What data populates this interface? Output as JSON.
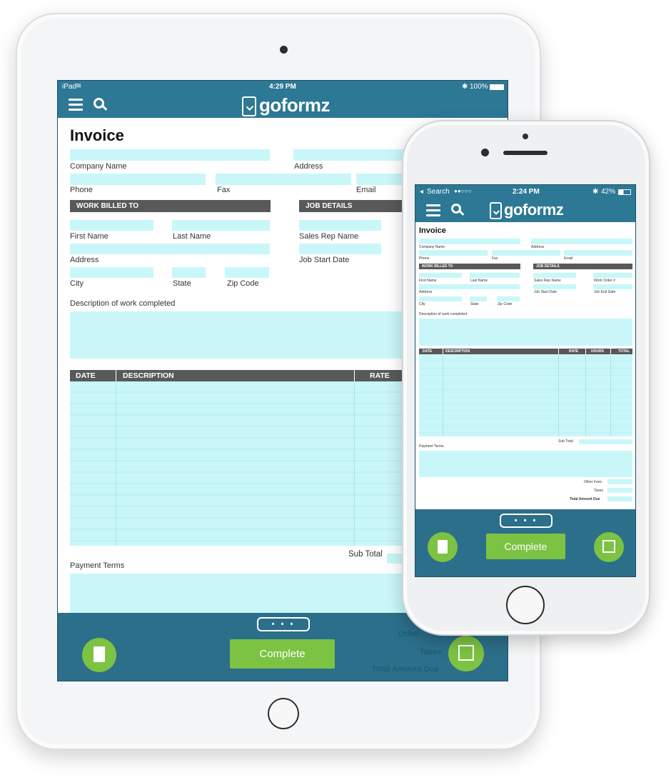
{
  "ipad": {
    "status": {
      "device": "iPad",
      "time": "4:29 PM",
      "battery": "100%"
    },
    "logo": "goformz",
    "form": {
      "title": "Invoice",
      "labels": {
        "company_name": "Company Name",
        "address": "Address",
        "phone": "Phone",
        "fax": "Fax",
        "email": "Email",
        "first_name": "First Name",
        "last_name": "Last Name",
        "sales_rep": "Sales Rep Name",
        "address2": "Address",
        "job_start": "Job Start Date",
        "city": "City",
        "state": "State",
        "zip": "Zip Code",
        "description": "Description of work completed",
        "payment_terms": "Payment Terms",
        "sub_total": "Sub Total",
        "other_fees": "Other",
        "taxes": "Taxes",
        "total_due": "Total Amount Due"
      },
      "sections": {
        "work_billed": "WORK BILLED TO",
        "job_details": "JOB DETAILS"
      },
      "table_columns": [
        "DATE",
        "DESCRIPTION",
        "RATE"
      ]
    },
    "bottom": {
      "more": "• • •",
      "complete": "Complete"
    }
  },
  "phone": {
    "status": {
      "carrier": "Search",
      "signal": "●●○○○",
      "time": "2:24 PM",
      "battery": "42%"
    },
    "logo": "goformz",
    "form": {
      "title": "Invoice",
      "labels": {
        "company_name": "Company Name",
        "address": "Address",
        "phone": "Phone",
        "fax": "Fax",
        "email": "Email",
        "first_name": "First Name",
        "last_name": "Last Name",
        "sales_rep": "Sales Rep Name",
        "work_order": "Work Order #",
        "address2": "Address",
        "job_start": "Job Start Date",
        "job_end": "Job End Date",
        "city": "City",
        "state": "State",
        "zip": "Zip Code",
        "description": "Description of work completed",
        "sub_total": "Sub Total",
        "payment_terms": "Payment Terms",
        "other_fees": "Other Fees",
        "taxes": "Taxes",
        "total_due": "Total Amount Due"
      },
      "sections": {
        "work_billed": "WORK BILLED TO",
        "job_details": "JOB DETAILS"
      },
      "table_columns": [
        "DATE",
        "DESCRIPTION",
        "RATE",
        "HOURS",
        "TOTAL"
      ]
    },
    "bottom": {
      "more": "• • •",
      "complete": "Complete"
    }
  },
  "colors": {
    "header": "#2c7895",
    "field": "#c9f7f9",
    "section": "#58595b",
    "button": "#7cc243"
  }
}
